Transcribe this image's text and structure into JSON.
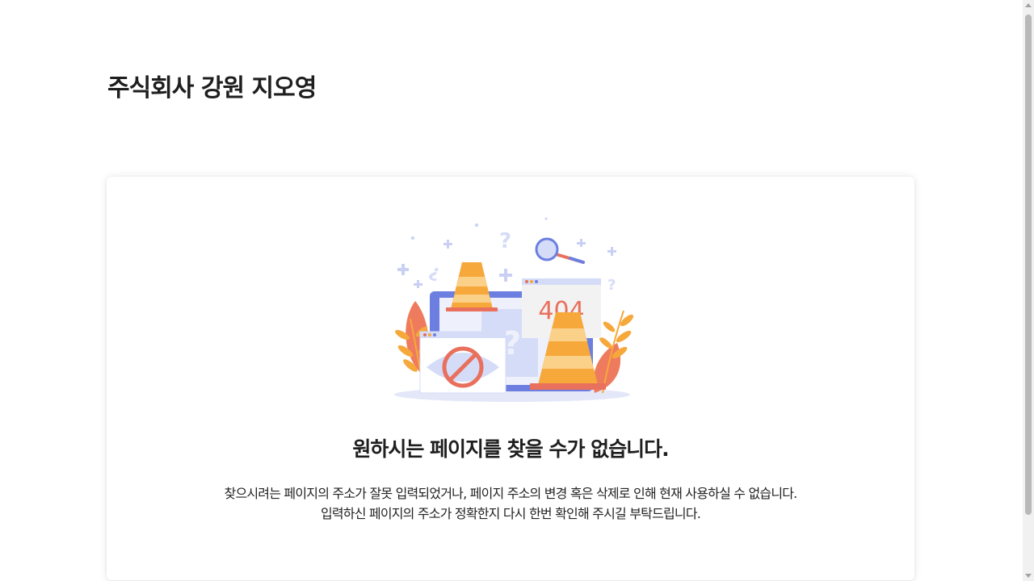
{
  "header": {
    "company_name": "주식회사 강원 지오영"
  },
  "error_card": {
    "illustration": {
      "icon": "404-error-illustration-icon",
      "code_text": "404",
      "question_mark": "?",
      "colors": {
        "accent_red": "#e8705c",
        "cone_orange": "#f6a83b",
        "monitor_blue": "#6c7fe0",
        "light_blue": "#d5dcf7"
      }
    },
    "heading": "원하시는 페이지를 찾을 수가 없습니다.",
    "description_line1": "찾으시려는 페이지의 주소가 잘못 입력되었거나, 페이지 주소의 변경 혹은 삭제로 인해 현재 사용하실 수 없습니다.",
    "description_line2": "입력하신 페이지의 주소가 정확한지 다시 한번 확인해 주시길 부탁드립니다."
  }
}
